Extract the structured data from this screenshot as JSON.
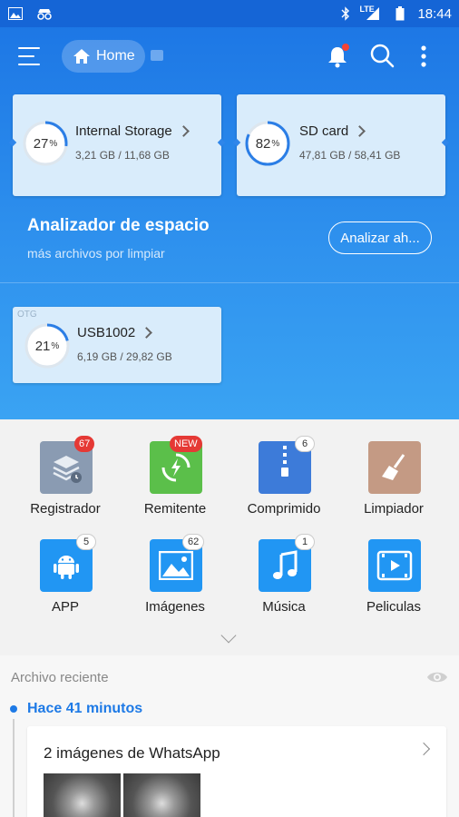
{
  "status_bar": {
    "time": "18:44",
    "network": "LTE"
  },
  "app_bar": {
    "home_label": "Home"
  },
  "storage": [
    {
      "name": "Internal Storage",
      "percent": 27,
      "used": "3,21 GB",
      "total": "11,68 GB",
      "size_text": "3,21 GB / 11,68 GB",
      "tag": ""
    },
    {
      "name": "SD card",
      "percent": 82,
      "used": "47,81 GB",
      "total": "58,41 GB",
      "size_text": "47,81 GB / 58,41 GB",
      "tag": ""
    },
    {
      "name": "USB1002",
      "percent": 21,
      "used": "6,19 GB",
      "total": "29,82 GB",
      "size_text": "6,19 GB / 29,82 GB",
      "tag": "OTG"
    }
  ],
  "pct_symbol": "%",
  "analyzer": {
    "title": "Analizador de espacio",
    "subtitle": "más archivos por limpiar",
    "button": "Analizar ah..."
  },
  "categories": [
    {
      "label": "Registrador",
      "badge": "67",
      "icon": "log-recorder-icon",
      "color": "#8a9bb2"
    },
    {
      "label": "Remitente",
      "badge": "NEW",
      "icon": "sender-transfer-icon",
      "color": "#5bbf4a"
    },
    {
      "label": "Comprimido",
      "badge": "6",
      "icon": "zip-archive-icon",
      "color": "#3d7bd9"
    },
    {
      "label": "Limpiador",
      "badge": "",
      "icon": "broom-cleaner-icon",
      "color": "#c49a84"
    },
    {
      "label": "APP",
      "badge": "5",
      "icon": "android-icon",
      "color": "#2196f3"
    },
    {
      "label": "Imágenes",
      "badge": "62",
      "icon": "image-icon",
      "color": "#2196f3"
    },
    {
      "label": "Música",
      "badge": "1",
      "icon": "music-note-icon",
      "color": "#2196f3"
    },
    {
      "label": "Peliculas",
      "badge": "",
      "icon": "video-play-icon",
      "color": "#2196f3"
    }
  ],
  "recent": {
    "title": "Archivo reciente",
    "time_label": "Hace 41 minutos",
    "item_title": "2 imágenes de WhatsApp"
  },
  "colors": {
    "accent": "#1e7ae6",
    "badge_red": "#e53935",
    "ring": "#2b7ee6"
  }
}
